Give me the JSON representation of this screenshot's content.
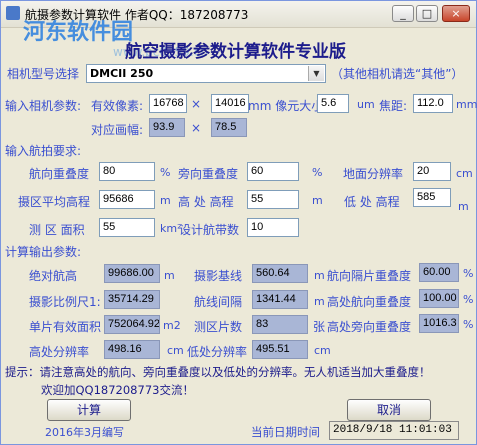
{
  "title_bar": {
    "title": "航摄参数计算软件  作者QQ：187208773",
    "min": "_",
    "max": "□",
    "close": "×"
  },
  "watermark": {
    "brand": "河东软件园",
    "url": "www.pc0359.cn"
  },
  "heading": "航空摄影参数计算软件专业版",
  "camera": {
    "label": "相机型号选择",
    "selected": "DMCII 250",
    "note": "（其他相机请选“其他”）"
  },
  "camera_params": {
    "label": "输入相机参数:",
    "pixels_label": "有效像素:",
    "pixels_w": "16768",
    "times": "×",
    "pixels_h": "14016",
    "pixel_size_label": "mm 像元大小:",
    "pixel_size": "5.6",
    "pixel_size_unit": "um",
    "focal_label": "焦距:",
    "focal": "112.0",
    "focal_unit": "mm",
    "frame_label": "对应画幅:",
    "frame_w": "93.9",
    "frame_times": "×",
    "frame_h": "78.5"
  },
  "flight": {
    "label": "输入航拍要求:",
    "forward_overlap_label": "航向重叠度",
    "forward_overlap": "80",
    "forward_unit": "%",
    "side_overlap_label": "旁向重叠度",
    "side_overlap": "60",
    "side_unit": "%",
    "gsd_label": "地面分辨率",
    "gsd": "20",
    "gsd_unit": "cm",
    "avg_elev_label": "摄区平均高程",
    "avg_elev": "95686",
    "avg_elev_unit": "m",
    "high_elev_label": "高 处 高程",
    "high_elev": "55",
    "high_elev_unit": "m",
    "low_elev_label": "低 处 高程",
    "low_elev": "585",
    "low_elev_unit": "m",
    "area_label": "测 区 面积",
    "area": "55",
    "area_unit": "km²",
    "strips_label": "设计航带数",
    "strips": "10"
  },
  "output": {
    "label": "计算输出参数:",
    "abs_height_label": "绝对航高",
    "abs_height": "99686.00",
    "abs_height_unit": "m",
    "baseline_label": "摄影基线",
    "baseline": "560.64",
    "baseline_unit": "m",
    "interval_overlap_label": "航向隔片重叠度",
    "interval_overlap": "60.00",
    "interval_overlap_unit": "%",
    "scale_label": "摄影比例尺1:",
    "scale": "35714.29",
    "line_spacing_label": "航线间隔",
    "line_spacing": "1341.44",
    "line_spacing_unit": "m",
    "high_fwd_label": "高处航向重叠度",
    "high_fwd": "100.00",
    "high_fwd_unit": "%",
    "photo_area_label": "单片有效面积",
    "photo_area": "752064.92",
    "photo_area_unit": "m2",
    "photo_count_label": "测区片数",
    "photo_count": "83",
    "photo_count_unit": "张",
    "high_side_label": "高处旁向重叠度",
    "high_side": "1016.3",
    "high_side_unit": "%",
    "high_res_label": "高处分辨率",
    "high_res": "498.16",
    "high_res_unit": "cm",
    "low_res_label": "低处分辨率",
    "low_res": "495.51",
    "low_res_unit": "cm"
  },
  "tips": {
    "line1": "提示：请注意高处的航向、旁向重叠度以及低处的分辨率。无人机适当加大重叠度！",
    "line2": "欢迎加QQ187208773交流！"
  },
  "buttons": {
    "calc": "计算",
    "cancel": "取消"
  },
  "footer": {
    "date_written": "2016年3月编写",
    "current_date_label": "当前日期时间",
    "current_date": "2018/9/18 11:01:03"
  }
}
